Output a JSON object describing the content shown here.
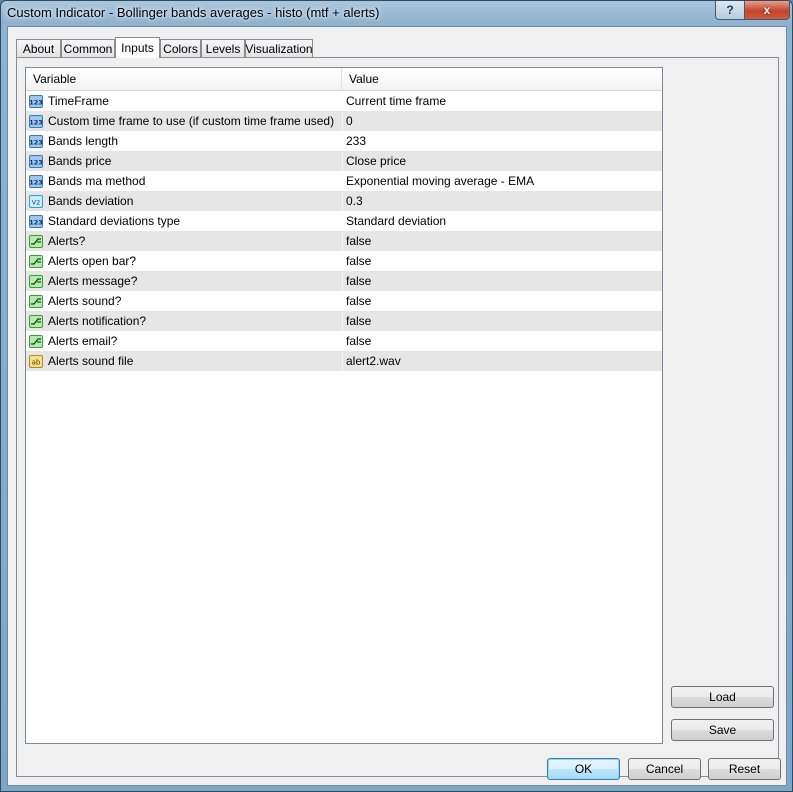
{
  "window": {
    "title": "Custom Indicator - Bollinger bands averages - histo (mtf + alerts)",
    "help_label": "?",
    "close_label": "x"
  },
  "tabs": [
    {
      "label": "About"
    },
    {
      "label": "Common"
    },
    {
      "label": "Inputs",
      "active": true
    },
    {
      "label": "Colors"
    },
    {
      "label": "Levels"
    },
    {
      "label": "Visualization"
    }
  ],
  "grid": {
    "headers": {
      "variable": "Variable",
      "value": "Value"
    },
    "rows": [
      {
        "icon": "integer-icon",
        "name": "TimeFrame",
        "value": "Current time frame"
      },
      {
        "icon": "integer-icon",
        "name": "Custom time frame to use (if custom time frame used)",
        "value": "0"
      },
      {
        "icon": "integer-icon",
        "name": "Bands length",
        "value": "233"
      },
      {
        "icon": "integer-icon",
        "name": "Bands price",
        "value": "Close price"
      },
      {
        "icon": "integer-icon",
        "name": "Bands ma method",
        "value": "Exponential moving average - EMA"
      },
      {
        "icon": "double-icon",
        "name": "Bands deviation",
        "value": "0.3"
      },
      {
        "icon": "integer-icon",
        "name": "Standard deviations type",
        "value": "Standard deviation"
      },
      {
        "icon": "bool-icon",
        "name": "Alerts?",
        "value": "false"
      },
      {
        "icon": "bool-icon",
        "name": "Alerts open bar?",
        "value": "false"
      },
      {
        "icon": "bool-icon",
        "name": "Alerts message?",
        "value": "false"
      },
      {
        "icon": "bool-icon",
        "name": "Alerts sound?",
        "value": "false"
      },
      {
        "icon": "bool-icon",
        "name": "Alerts notification?",
        "value": "false"
      },
      {
        "icon": "bool-icon",
        "name": "Alerts email?",
        "value": "false"
      },
      {
        "icon": "string-icon",
        "name": "Alerts sound file",
        "value": "alert2.wav"
      }
    ]
  },
  "icon_text": {
    "integer-icon": "123",
    "double-icon": "V2",
    "string-icon": "ab"
  },
  "buttons": {
    "load": "Load",
    "save": "Save",
    "ok": "OK",
    "cancel": "Cancel",
    "reset": "Reset"
  }
}
